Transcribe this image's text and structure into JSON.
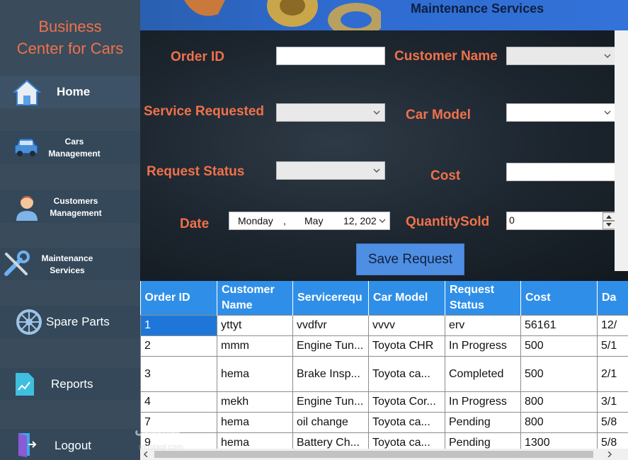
{
  "sidebar": {
    "brand_line1": "Business",
    "brand_line2": "Center for Cars",
    "items": [
      {
        "label": "Home"
      },
      {
        "label1": "Cars",
        "label2": "Management"
      },
      {
        "label1": "Customers",
        "label2": "Management"
      },
      {
        "label1": "Maintenance",
        "label2": "Services"
      },
      {
        "label": "Spare Parts"
      },
      {
        "label": "Reports"
      },
      {
        "label": "Logout"
      }
    ]
  },
  "header": {
    "title": "Maintenance Services"
  },
  "form": {
    "order_id_label": "Order ID",
    "order_id_value": "",
    "customer_name_label": "Customer Name",
    "service_requested_label": "Service Requested",
    "car_model_label": "Car Model",
    "request_status_label": "Request Status",
    "cost_label": "Cost",
    "cost_value": "",
    "date_label": "Date",
    "date_weekday": "Monday",
    "date_sep": ",",
    "date_month": "May",
    "date_day_year": "12, 202",
    "quantity_label": "QuantitySold",
    "quantity_value": "0",
    "save_label": "Save Request"
  },
  "table": {
    "columns": [
      "Order ID",
      "Customer Name",
      "Servicerequ",
      "Car Model",
      "Request Status",
      "Cost",
      "Da"
    ],
    "rows": [
      [
        "1",
        "yttyt",
        "vvdfvr",
        "vvvv",
        "erv",
        "56161",
        "12/"
      ],
      [
        "2",
        "mmm",
        "Engine Tun...",
        "Toyota CHR",
        "In Progress",
        "500",
        "5/1"
      ],
      [
        "3",
        "hema",
        "Brake Insp...",
        "Toyota ca...",
        "Completed",
        "500",
        "2/1"
      ],
      [
        "4",
        "mekh",
        "Engine Tun...",
        "Toyota Cor...",
        "In Progress",
        "800",
        "3/1"
      ],
      [
        "7",
        "hema",
        "oil change",
        "Toyota ca...",
        "Pending",
        "800",
        "5/8"
      ],
      [
        "9",
        "hema",
        "Battery Ch...",
        "Toyota ca...",
        "Pending",
        "1300",
        "5/8"
      ]
    ]
  },
  "colors": {
    "accent": "#f0714a",
    "header_blue": "#2f8fe8",
    "button_blue": "#4f8fe3",
    "sidebar": "#3a4c5c"
  },
  "watermark": {
    "text": "مستقل",
    "sub": "mostaql.com"
  }
}
